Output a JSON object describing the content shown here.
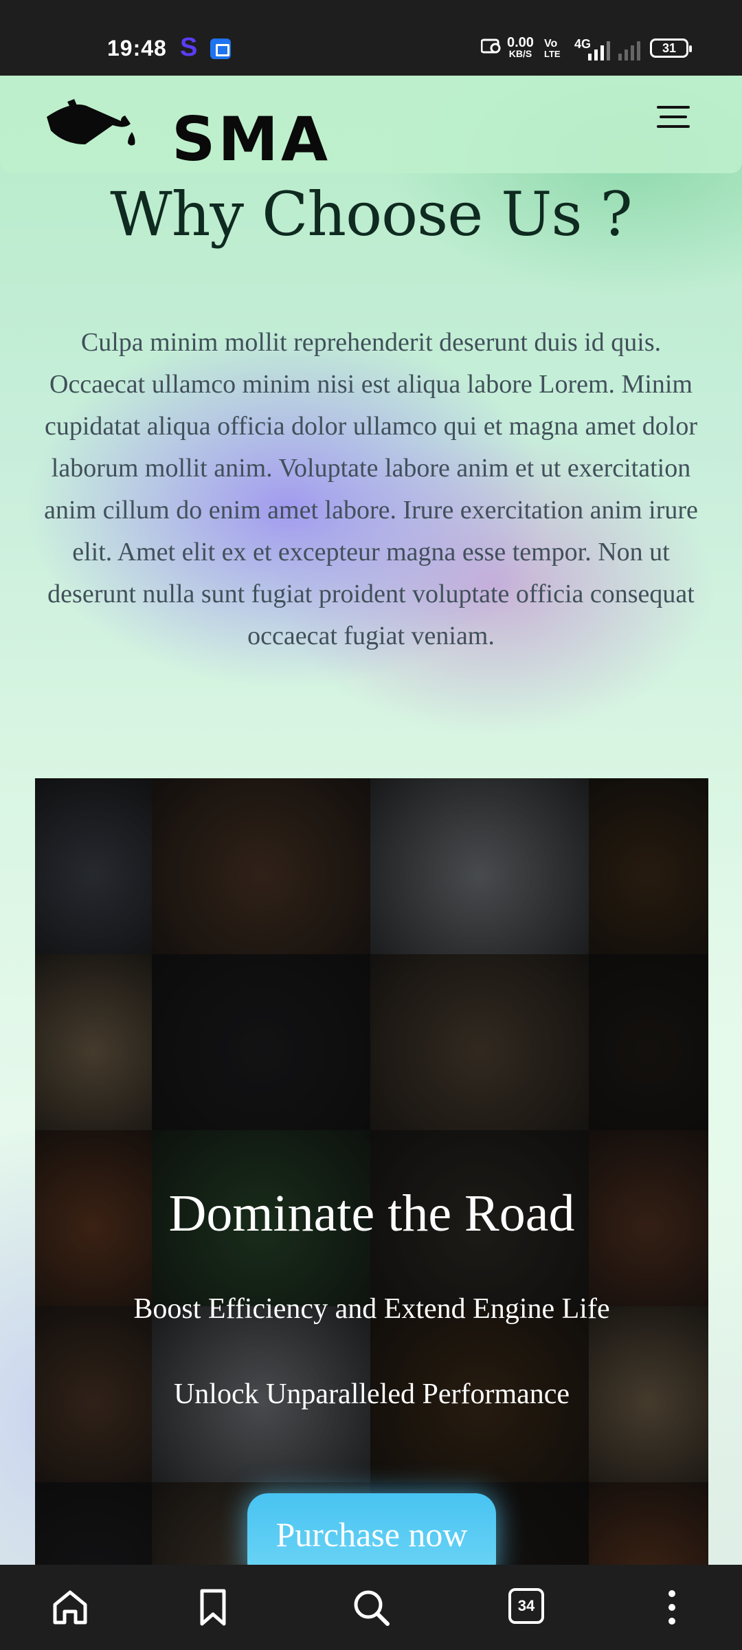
{
  "status_bar": {
    "time": "19:48",
    "net_speed_value": "0.00",
    "net_speed_unit": "KB/S",
    "volte_top": "Vo",
    "volte_bottom": "LTE",
    "network": "4G",
    "battery": "31"
  },
  "header": {
    "logo_text": "SMA"
  },
  "main": {
    "heading": "Why Choose Us ?",
    "intro": "Culpa minim mollit reprehenderit deserunt duis id quis. Occaecat ullamco minim nisi est aliqua labore Lorem. Minim cupidatat aliqua officia dolor ullamco qui et magna amet dolor laborum mollit anim. Voluptate labore anim et ut exercitation anim cillum do enim amet labore. Irure exercitation anim irure elit. Amet elit ex et excepteur magna esse tempor. Non ut deserunt nulla sunt fugiat proident voluptate officia consequat occaecat fugiat veniam."
  },
  "hero": {
    "title": "Dominate the Road",
    "subtitle1": "Boost Efficiency and Extend Engine Life",
    "subtitle2": "Unlock Unparalleled Performance",
    "cta_label": "Purchase now"
  },
  "gallery": {
    "tiles": [
      {
        "name": "camera-photo",
        "color": "#3b3f48"
      },
      {
        "name": "latte-coffee-photo",
        "color": "#4a3426"
      },
      {
        "name": "hats-photo",
        "color": "#6f7378"
      },
      {
        "name": "honey-jar-photo",
        "color": "#3b2a18"
      },
      {
        "name": "starfish-photo",
        "color": "#6b5b45"
      },
      {
        "name": "bicycle-photo",
        "color": "#1d1d1f"
      },
      {
        "name": "breakfast-photo",
        "color": "#4d4032"
      },
      {
        "name": "burger-photo",
        "color": "#1f1a16"
      },
      {
        "name": "basketball-photo",
        "color": "#5a341f"
      },
      {
        "name": "fern-leaves-photo",
        "color": "#27452a"
      },
      {
        "name": "mushroom-photo",
        "color": "#2d2a24"
      },
      {
        "name": "tomatoes-photo",
        "color": "#503020"
      }
    ]
  },
  "bottom_nav": {
    "tabs_count": "34"
  }
}
